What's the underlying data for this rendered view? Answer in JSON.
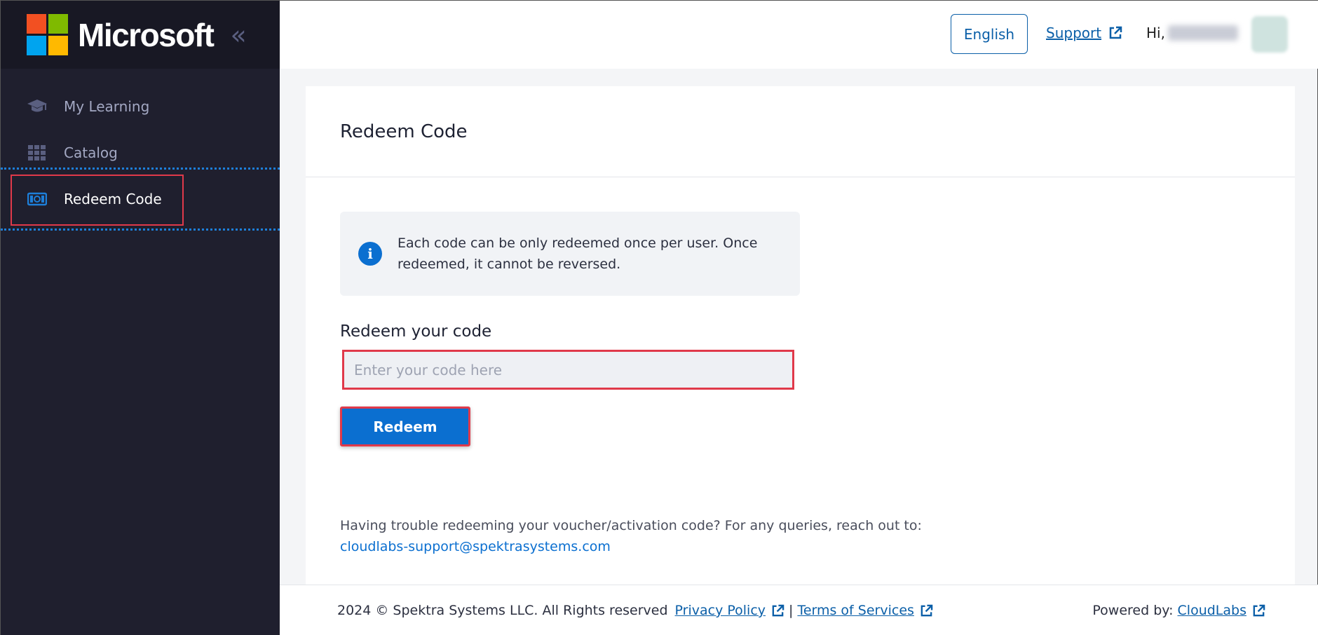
{
  "brand": {
    "name": "Microsoft",
    "logo_colors": [
      "#f25022",
      "#7fba00",
      "#00a4ef",
      "#ffb900"
    ]
  },
  "sidebar": {
    "collapse_icon": "double-chevron-left-icon",
    "items": [
      {
        "label": "My Learning",
        "icon": "graduation-cap-icon",
        "active": false
      },
      {
        "label": "Catalog",
        "icon": "grid-icon",
        "active": false
      },
      {
        "label": "Redeem Code",
        "icon": "money-bill-icon",
        "active": true
      }
    ]
  },
  "topbar": {
    "language": "English",
    "support": "Support",
    "greeting": "Hi,"
  },
  "main": {
    "title": "Redeem Code",
    "info_text": "Each code can be only redeemed once per user. Once redeemed, it cannot be reversed.",
    "field_label": "Redeem your code",
    "input_placeholder": "Enter your code here",
    "input_value": "",
    "redeem_button": "Redeem",
    "help_text": "Having trouble redeeming your voucher/activation code? For any queries, reach out to:",
    "help_email": "cloudlabs-support@spektrasystems.com"
  },
  "footer": {
    "copyright": "2024 © Spektra Systems LLC. All Rights reserved",
    "privacy": "Privacy Policy",
    "separator": "|",
    "terms": "Terms of Services",
    "powered_by": "Powered by:",
    "cloudlabs": "CloudLabs"
  },
  "colors": {
    "sidebar_bg": "#1f1f2e",
    "accent_blue": "#0b6fd0",
    "highlight_red": "#e0394a"
  }
}
